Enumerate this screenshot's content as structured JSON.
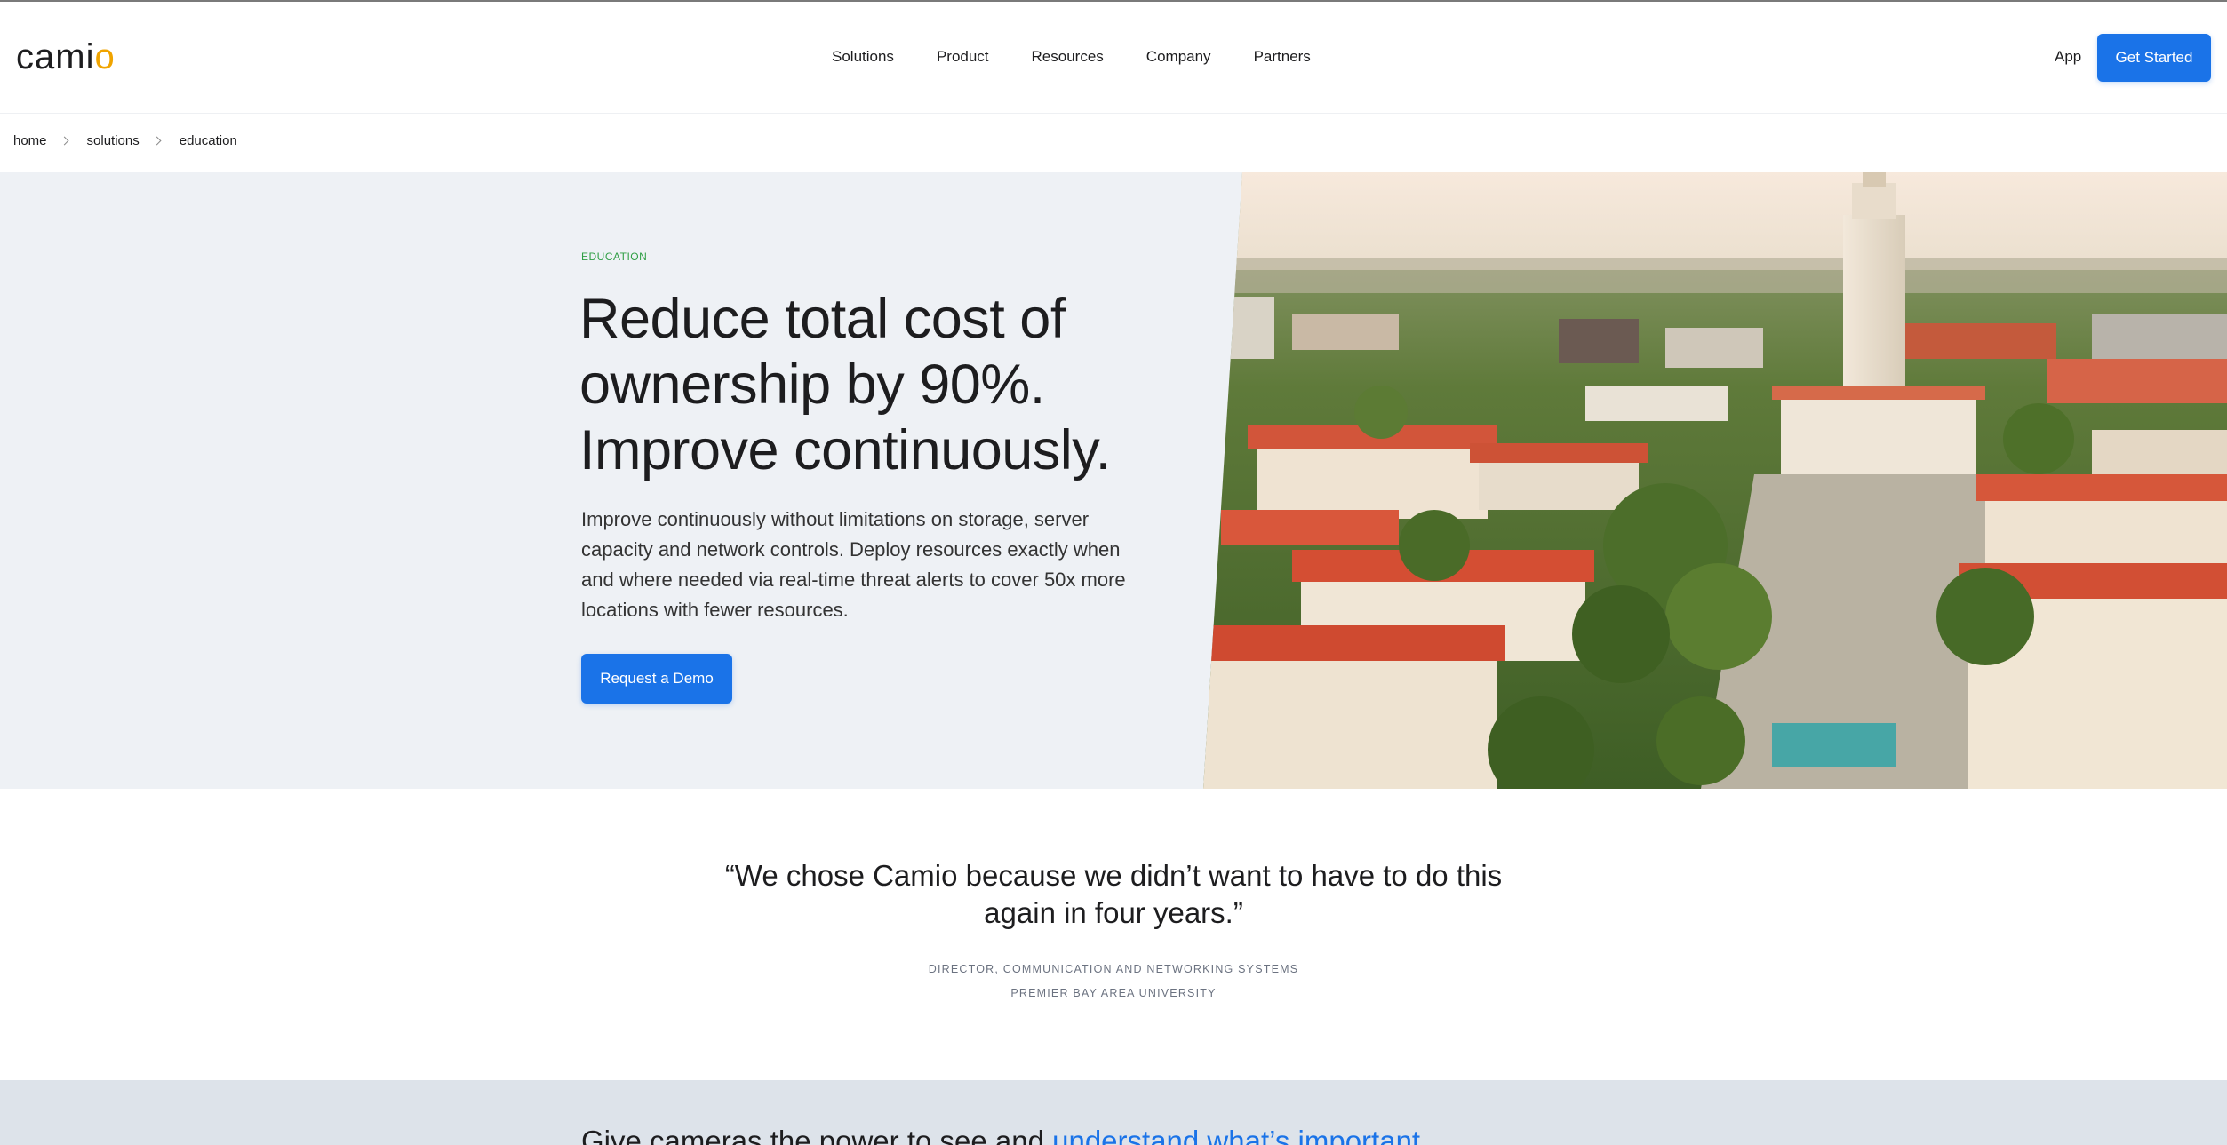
{
  "brand": {
    "logo_main": "cami",
    "logo_accent": "o",
    "accent_color": "#f0a400"
  },
  "nav": {
    "items": [
      "Solutions",
      "Product",
      "Resources",
      "Company",
      "Partners"
    ],
    "app_label": "App",
    "cta_label": "Get Started"
  },
  "breadcrumb": [
    "home",
    "solutions",
    "education"
  ],
  "hero": {
    "eyebrow": "EDUCATION",
    "title_lines": [
      "Reduce total cost of",
      "ownership by 90%.",
      "Improve continuously."
    ],
    "body": "Improve continuously without limitations on storage, server capacity and network controls. Deploy resources exactly when and where needed via real-time threat alerts to cover 50x more locations with fewer resources.",
    "cta_label": "Request a Demo",
    "image_subject": "aerial-campus-photo"
  },
  "testimonial": {
    "quote": "“We chose Camio because we didn’t want to have to do this again in four years.”",
    "attribution_title": "DIRECTOR, COMMUNICATION AND NETWORKING SYSTEMS",
    "attribution_org": "PREMIER BAY AREA UNIVERSITY"
  },
  "next_section": {
    "heading_plain": "Give cameras the power to see and ",
    "heading_link": "understand what’s important"
  },
  "colors": {
    "primary": "#1a73e8",
    "eyebrow": "#2f9e44",
    "hero_bg": "#eef1f5",
    "band_bg": "#dde3ea"
  }
}
